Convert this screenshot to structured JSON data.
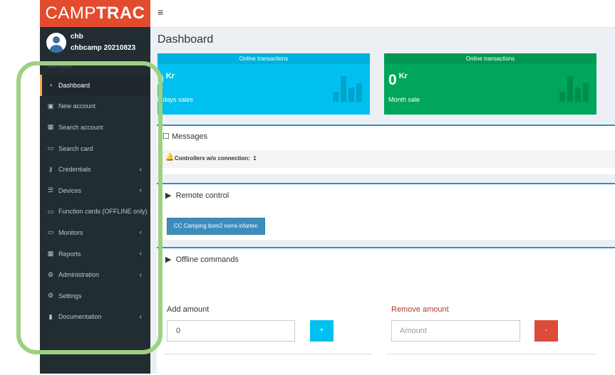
{
  "brand": {
    "logo_light": "CAMP",
    "logo_bold": "TRAC"
  },
  "user": {
    "name": "chb",
    "org": "chbcamp 20210823"
  },
  "sidebar": {
    "header": "Main menu",
    "items": [
      {
        "label": "Dashboard",
        "icon": "dashboard-icon",
        "active": true,
        "has_submenu": false
      },
      {
        "label": "New account",
        "icon": "calendar-plus-icon",
        "has_submenu": false
      },
      {
        "label": "Search account",
        "icon": "calendar-icon",
        "has_submenu": false
      },
      {
        "label": "Search card",
        "icon": "credit-card-icon",
        "has_submenu": false
      },
      {
        "label": "Credentials",
        "icon": "key-icon",
        "has_submenu": true
      },
      {
        "label": "Devices",
        "icon": "server-icon",
        "has_submenu": true
      },
      {
        "label": "Function cards (OFFLINE only)",
        "icon": "credit-card-icon",
        "has_submenu": false
      },
      {
        "label": "Monitors",
        "icon": "monitor-icon",
        "has_submenu": true
      },
      {
        "label": "Reports",
        "icon": "calendar-icon",
        "has_submenu": true
      },
      {
        "label": "Administration",
        "icon": "cogs-icon",
        "has_submenu": true
      },
      {
        "label": "Settings",
        "icon": "gear-icon",
        "has_submenu": false
      },
      {
        "label": "Documentation",
        "icon": "file-icon",
        "has_submenu": true
      }
    ]
  },
  "topbar": {
    "menu_toggle": "≡"
  },
  "dashboard": {
    "title": "Dashboard",
    "stats": [
      {
        "header": "Online transactions",
        "value": "0",
        "unit": "Kr",
        "sublabel": "Todays sales",
        "color": "#00c0ef"
      },
      {
        "header": "Online transactions",
        "value": "0",
        "unit": "Kr",
        "sublabel": "Month sale",
        "color": "#00a65a"
      }
    ],
    "messages": {
      "title": "Messages",
      "alert_label": "Controllers w/o connection:",
      "alert_count": "1"
    },
    "remote_control": {
      "title": "Remote control",
      "button_label": "CC Camping bom2 norra infarten"
    },
    "offline_commands": {
      "title": "Offline commands",
      "add_label": "Add amount",
      "add_value": "0",
      "add_button": "+",
      "remove_label": "Remove amount",
      "remove_placeholder": "Amount",
      "remove_button": "-"
    }
  },
  "colors": {
    "brand_red": "#e34b2e",
    "sidebar_bg": "#222d32",
    "accent_blue": "#3c8dbc",
    "aqua": "#00c0ef",
    "green": "#00a65a",
    "danger": "#dd4b39",
    "highlight_outline": "#9dd181"
  }
}
